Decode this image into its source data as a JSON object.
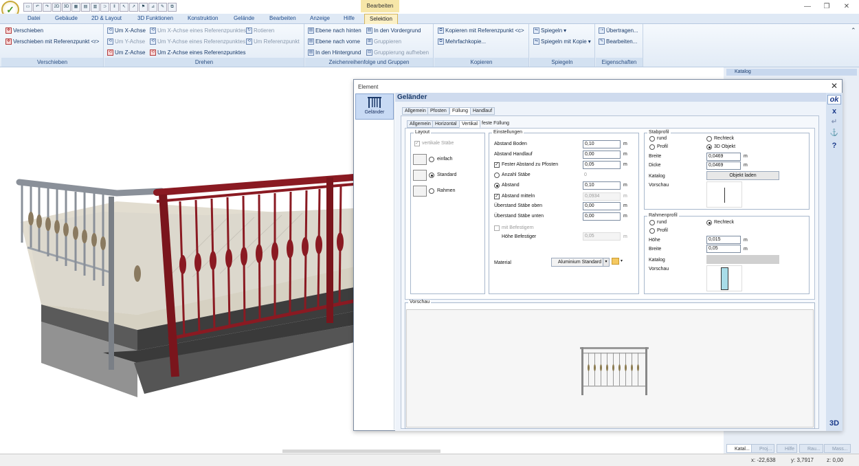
{
  "window": {
    "context_tab": "Bearbeiten"
  },
  "tabs": [
    "Datei",
    "Gebäude",
    "2D & Layout",
    "3D Funktionen",
    "Konstruktion",
    "Gelände",
    "Bearbeiten",
    "Anzeige",
    "Hilfe",
    "Selektion"
  ],
  "ribbon": {
    "verschieben": {
      "label": "Verschieben",
      "items": [
        "Verschieben",
        "Verschieben mit Referenzpunkt <r>"
      ]
    },
    "drehen": {
      "label": "Drehen",
      "items": [
        "Um X-Achse",
        "Um X-Achse eines Referenzpunktes",
        "Rotieren",
        "Um Y-Achse",
        "Um Y-Achse eines Referenzpunktes",
        "Um Referenzpunkt",
        "Um Z-Achse",
        "Um Z-Achse eines Referenzpunktes"
      ]
    },
    "zeichen": {
      "label": "Zeichenreihenfolge und Gruppen",
      "items": [
        "Ebene nach hinten",
        "In den Vordergrund",
        "Ebene nach vorne",
        "Gruppieren",
        "In den Hintergrund",
        "Gruppierung aufheben"
      ]
    },
    "kopieren": {
      "label": "Kopieren",
      "items": [
        "Kopieren mit Referenzpunkt <c>",
        "Mehrfachkopie..."
      ]
    },
    "spiegeln": {
      "label": "Spiegeln",
      "items": [
        "Spiegeln",
        "Spiegeln mit Kopie"
      ]
    },
    "eigenschaften": {
      "label": "Eigenschaften",
      "items": [
        "Übertragen...",
        "Bearbeiten..."
      ]
    }
  },
  "right_panel": {
    "katalog_title": "Katalog",
    "bottom_tabs": [
      "Katal...",
      "Proj...",
      "Hilfe",
      "Rau...",
      "Mass..."
    ]
  },
  "status": {
    "x": "x: -22,638",
    "y": "y: 3,7917",
    "z": "z: 0,00"
  },
  "dialog": {
    "title": "Element",
    "sidebar_item": "Geländer",
    "header": "Geländer",
    "tabs": [
      "Allgemein",
      "Pfosten",
      "Füllung",
      "Handlauf"
    ],
    "subtabs": [
      "Allgemein",
      "Horizontal",
      "Vertikal",
      "feste Füllung"
    ],
    "toolbar": {
      "ok": "ok",
      "cancel": "x",
      "undo": "↵",
      "anchor": "⚓",
      "help": "?",
      "view3d": "3D"
    },
    "layout": {
      "title": "Layout",
      "vertical_bars": "vertikale Stäbe",
      "options": [
        "einfach",
        "Standard",
        "Rahmen"
      ]
    },
    "einstellungen": {
      "title": "Einstellungen",
      "abstand_boden": {
        "label": "Abstand Boden",
        "value": "0,10",
        "unit": "m"
      },
      "abstand_handlauf": {
        "label": "Abstand Handlauf",
        "value": "0,00",
        "unit": "m"
      },
      "fester_abstand": {
        "label": "Fester Abstand zu Pfosten",
        "value": "0,05",
        "unit": "m"
      },
      "anzahl_staebe": {
        "label": "Anzahl Stäbe",
        "value": "0"
      },
      "abstand": {
        "label": "Abstand",
        "value": "0,10",
        "unit": "m"
      },
      "abstand_mitteln": {
        "label": "Abstand mitteln",
        "value": "0,0934",
        "unit": "m"
      },
      "ueberstand_oben": {
        "label": "Überstand Stäbe oben",
        "value": "0,00",
        "unit": "m"
      },
      "ueberstand_unten": {
        "label": "Überstand Stäbe unten",
        "value": "0,00",
        "unit": "m"
      },
      "mit_befestigern": {
        "label": "mit Befestigern"
      },
      "hoehe_befestiger": {
        "label": "Höhe Befestiger",
        "value": "0,05",
        "unit": "m"
      },
      "material": {
        "label": "Material",
        "value": "Aluminium Standard"
      }
    },
    "stabprofil": {
      "title": "Stabprofil",
      "rund": "rund",
      "rechteck": "Rechteck",
      "profil": "Profil",
      "objekt": "3D Objekt",
      "breite": {
        "label": "Breite",
        "value": "0,0469",
        "unit": "m"
      },
      "dicke": {
        "label": "Dicke",
        "value": "0,0469",
        "unit": "m"
      },
      "katalog": "Katalog",
      "objekt_laden": "Objekt laden",
      "vorschau": "Vorschau"
    },
    "rahmenprofil": {
      "title": "Rahmenprofil",
      "rund": "rund",
      "rechteck": "Rechteck",
      "profil": "Profil",
      "hoehe": {
        "label": "Höhe",
        "value": "0,015",
        "unit": "m"
      },
      "breite": {
        "label": "Breite",
        "value": "0,05",
        "unit": "m"
      },
      "katalog": "Katalog",
      "vorschau": "Vorschau"
    },
    "vorschau_title": "Vorschau"
  },
  "colors": {
    "accent": "#1d4a8a",
    "ribbon_label": "#2a4d80",
    "context": "#f6e6a8",
    "railing_red": "#8a1a22",
    "railing_gray": "#8a9099"
  }
}
